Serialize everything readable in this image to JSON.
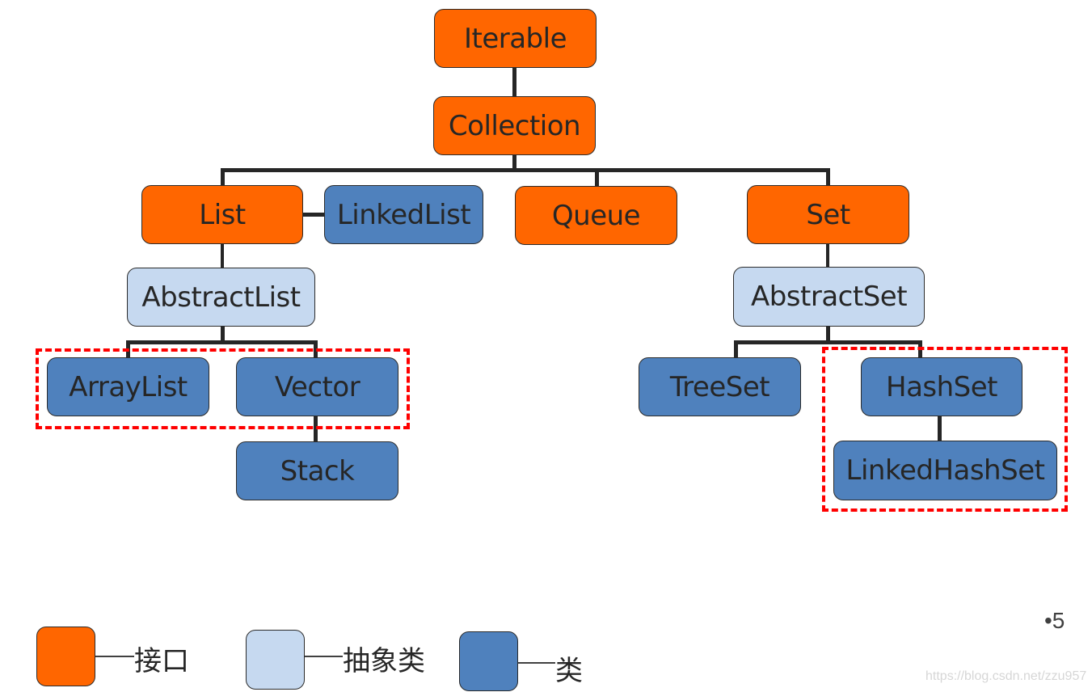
{
  "colors": {
    "interface": "#ff6600",
    "abstract_class": "#c6d9f0",
    "class": "#4f81bd",
    "highlight": "#ff0000",
    "connector": "#262626"
  },
  "nodes": {
    "iterable": {
      "label": "Iterable",
      "kind": "interface"
    },
    "collection": {
      "label": "Collection",
      "kind": "interface"
    },
    "list": {
      "label": "List",
      "kind": "interface"
    },
    "linkedlist": {
      "label": "LinkedList",
      "kind": "class"
    },
    "queue": {
      "label": "Queue",
      "kind": "interface"
    },
    "set": {
      "label": "Set",
      "kind": "interface"
    },
    "abstractlist": {
      "label": "AbstractList",
      "kind": "abstract"
    },
    "abstractset": {
      "label": "AbstractSet",
      "kind": "abstract"
    },
    "arraylist": {
      "label": "ArrayList",
      "kind": "class"
    },
    "vector": {
      "label": "Vector",
      "kind": "class"
    },
    "stack": {
      "label": "Stack",
      "kind": "class"
    },
    "treeset": {
      "label": "TreeSet",
      "kind": "class"
    },
    "hashset": {
      "label": "HashSet",
      "kind": "class"
    },
    "linkedhashset": {
      "label": "LinkedHashSet",
      "kind": "class"
    }
  },
  "edges": [
    [
      "iterable",
      "collection"
    ],
    [
      "collection",
      "list"
    ],
    [
      "collection",
      "queue"
    ],
    [
      "collection",
      "set"
    ],
    [
      "list",
      "linkedlist"
    ],
    [
      "list",
      "abstractlist"
    ],
    [
      "abstractlist",
      "arraylist"
    ],
    [
      "abstractlist",
      "vector"
    ],
    [
      "vector",
      "stack"
    ],
    [
      "set",
      "abstractset"
    ],
    [
      "abstractset",
      "treeset"
    ],
    [
      "abstractset",
      "hashset"
    ],
    [
      "hashset",
      "linkedhashset"
    ]
  ],
  "highlight_groups": [
    [
      "arraylist",
      "vector"
    ],
    [
      "hashset",
      "linkedhashset"
    ]
  ],
  "legend": [
    {
      "kind": "interface",
      "label": "接口"
    },
    {
      "kind": "abstract",
      "label": "抽象类"
    },
    {
      "kind": "class",
      "label": "类"
    }
  ],
  "page_number": "•5",
  "watermark": "https://blog.csdn.net/zzu957"
}
